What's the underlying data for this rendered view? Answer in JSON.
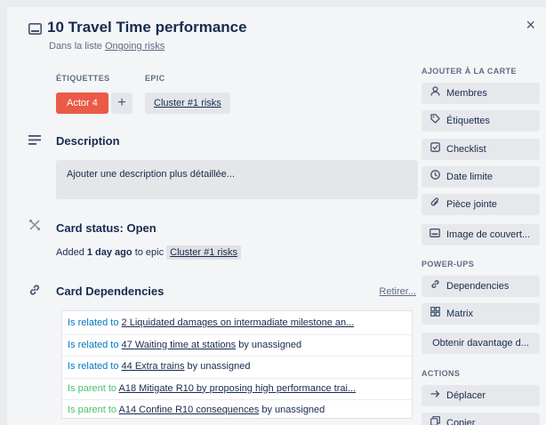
{
  "card": {
    "title": "10  Travel Time performance",
    "list_prefix": "Dans la liste",
    "list_name": "Ongoing risks",
    "close_glyph": "×"
  },
  "labels_section": {
    "label": "ÉTIQUETTES",
    "labels": [
      {
        "text": "Actor 4",
        "color": "#eb5a46"
      }
    ],
    "add_glyph": "+"
  },
  "epic_section": {
    "label": "EPIC",
    "value": "Cluster #1 risks"
  },
  "description": {
    "heading": "Description",
    "placeholder": "Ajouter une description plus détaillée..."
  },
  "card_status": {
    "heading": "Card status: Open",
    "prefix": "Added",
    "age": "1 day ago",
    "middle": "to epic",
    "epic": "Cluster #1 risks"
  },
  "dependencies": {
    "heading": "Card Dependencies",
    "remove_label": "Retirer...",
    "items": [
      {
        "relation": "Is related to",
        "kind": "related",
        "card": "2 Liquidated damages on intermadiate milestone an...",
        "tail": ""
      },
      {
        "relation": "Is related to",
        "kind": "related",
        "card": "47 Waiting time at stations",
        "tail": "by unassigned"
      },
      {
        "relation": "Is related to",
        "kind": "related",
        "card": "44 Extra trains",
        "tail": "by unassigned"
      },
      {
        "relation": "Is parent to",
        "kind": "parent",
        "card": "A18 Mitigate R10 by proposing high performance trai...",
        "tail": ""
      },
      {
        "relation": "Is parent to",
        "kind": "parent",
        "card": "A14 Confine R10 consequences",
        "tail": "by unassigned"
      }
    ]
  },
  "sidebar": {
    "add_to_card_label": "AJOUTER À LA CARTE",
    "add_to_card": [
      {
        "label": "Membres",
        "icon": "person-icon"
      },
      {
        "label": "Étiquettes",
        "icon": "tag-icon"
      },
      {
        "label": "Checklist",
        "icon": "checklist-icon"
      },
      {
        "label": "Date limite",
        "icon": "clock-icon"
      },
      {
        "label": "Pièce jointe",
        "icon": "paperclip-icon"
      },
      {
        "label": "Image de couvert...",
        "icon": "cover-image-icon"
      }
    ],
    "powerups_label": "POWER-UPS",
    "powerups": [
      {
        "label": "Dependencies",
        "icon": "link-icon"
      },
      {
        "label": "Matrix",
        "icon": "grid-icon"
      },
      {
        "label": "Obtenir davantage d...",
        "icon": ""
      }
    ],
    "actions_label": "ACTIONS",
    "actions": [
      {
        "label": "Déplacer",
        "icon": "arrow-right-icon"
      },
      {
        "label": "Copier",
        "icon": "copy-icon"
      }
    ]
  }
}
